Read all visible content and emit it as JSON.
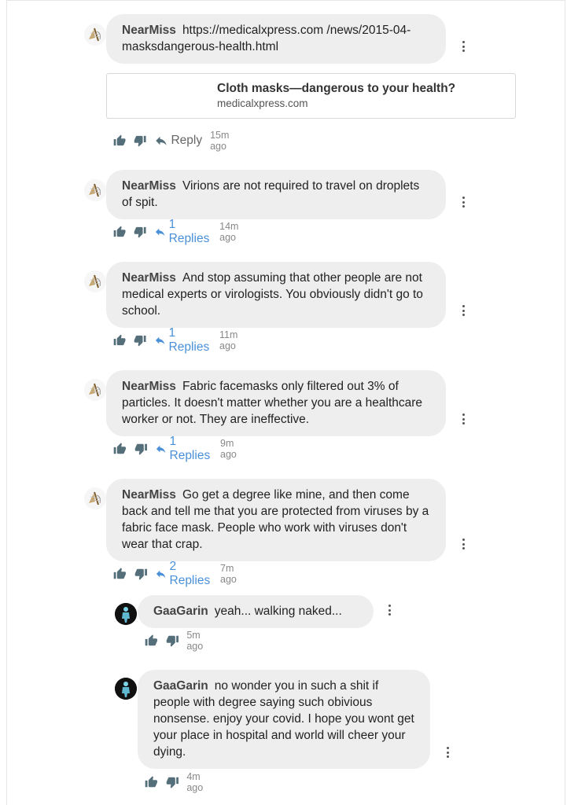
{
  "comments": [
    {
      "author": "NearMiss",
      "text": "https://medicalxpress.com /news/2015-04-masksdangerous-health.html",
      "reply_label": "Reply",
      "time": "15m ago",
      "link_card": {
        "title": "Cloth masks—dangerous to your health?",
        "domain": "medicalxpress.com"
      }
    },
    {
      "author": "NearMiss",
      "text": "Virions are not required to travel on droplets of spit.",
      "reply_label": "1 Replies",
      "time": "14m ago"
    },
    {
      "author": "NearMiss",
      "text": "And stop assuming that other people are not medical experts or virologists. You obviously didn't go to school.",
      "reply_label": "1 Replies",
      "time": "11m ago"
    },
    {
      "author": "NearMiss",
      "text": "Fabric facemasks only filtered out 3% of particles. It doesn't matter whether you are a healthcare worker or not. They are ineffective.",
      "reply_label": "1 Replies",
      "time": "9m ago"
    },
    {
      "author": "NearMiss",
      "text": "Go get a degree like mine, and then come back and tell me that you are protected from viruses by a fabric face mask. People who work with viruses don't wear that crap.",
      "reply_label": "2 Replies",
      "time": "7m ago"
    }
  ],
  "replies": [
    {
      "author": "GaaGarin",
      "text": "yeah... walking naked...",
      "time": "5m ago"
    },
    {
      "author": "GaaGarin",
      "text": "no wonder you in such a shit if people with degree saying such obivious nonsense. enjoy your covid. I hope you wont get your place in hospital and world will cheer your dying.",
      "time": "4m ago"
    }
  ],
  "icons": {
    "like": "thumbs-up-icon",
    "dislike": "thumbs-down-icon",
    "reply": "reply-arrow-icon",
    "more": "more-vertical-icon"
  },
  "colors": {
    "bubble": "#eeeeee",
    "reply_link": "#4a90d9",
    "icon": "#546e7a"
  }
}
